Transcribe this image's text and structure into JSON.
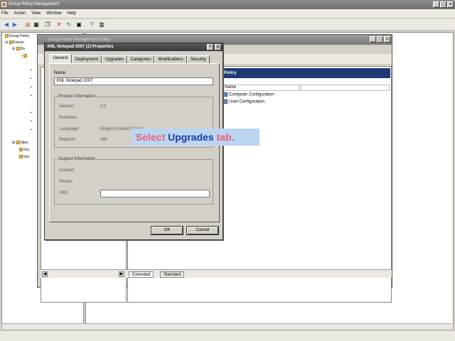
{
  "outer": {
    "title": "Group Policy Management",
    "menu": [
      "File",
      "Action",
      "View",
      "Window",
      "Help"
    ],
    "tree": [
      {
        "label": "Group Policy"
      },
      {
        "label": "Forest:"
      },
      {
        "label": "Do"
      },
      {
        "label": "Sites"
      },
      {
        "label": "Gro"
      },
      {
        "label": "Gro"
      }
    ]
  },
  "gpme": {
    "title": "Group Policy Management Editor",
    "policy_header": "Policy",
    "name_column": "Name",
    "rows": [
      "Computer Configuration",
      "User Configuration"
    ],
    "bottom_tabs": [
      "Extended",
      "Standard"
    ]
  },
  "dialog": {
    "title": "XML Notepad 2007 (2) Properties",
    "help_btn": "?",
    "close_btn": "X",
    "tabs": [
      "General",
      "Deployment",
      "Upgrades",
      "Categories",
      "Modifications",
      "Security"
    ],
    "active_tab": "General",
    "name_label": "Name:",
    "name_value": "XML Notepad 2007",
    "product_info": {
      "group_label": "Product information",
      "version_label": "Version:",
      "version_value": "2.0",
      "publisher_label": "Publisher:",
      "publisher_value": "",
      "language_label": "Language:",
      "language_value": "English (United States)",
      "platform_label": "Platform:",
      "platform_value": "x86"
    },
    "support_info": {
      "group_label": "Support information",
      "contact_label": "Contact:",
      "phone_label": "Phone:",
      "url_label": "URL:",
      "url_value": ""
    },
    "ok_label": "OK",
    "cancel_label": "Cancel"
  },
  "callout": {
    "part1": "Select",
    "part2": "Upgrades",
    "part3": "tab."
  }
}
